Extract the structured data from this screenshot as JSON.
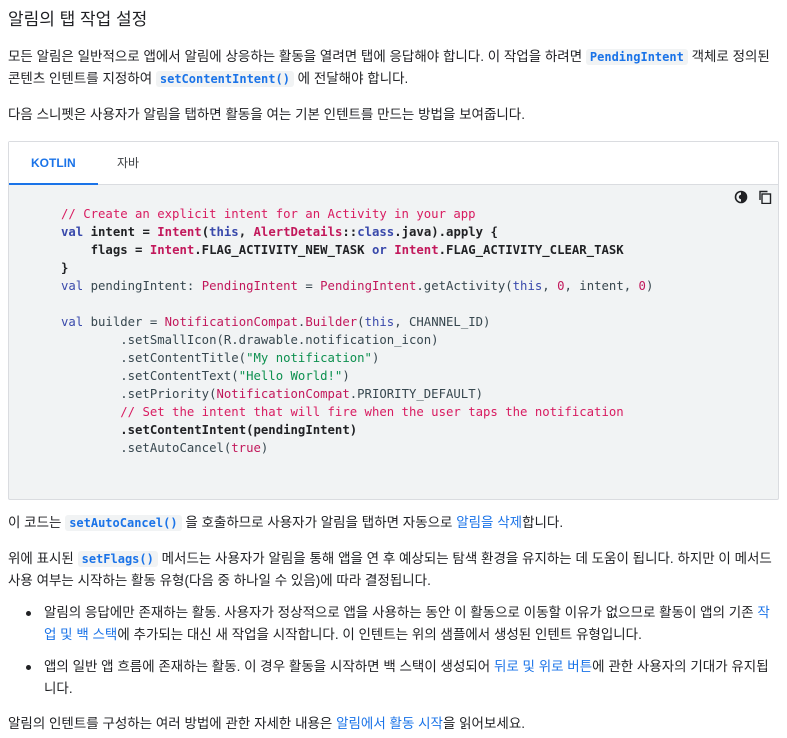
{
  "heading": "알림의 탭 작업 설정",
  "intro": {
    "text1": "모든 알림은 일반적으로 앱에서 알림에 상응하는 활동을 열려면 탭에 응답해야 합니다. 이 작업을 하려면 ",
    "code1": "PendingIntent",
    "text2": " 객체로 정의된 콘텐츠 인텐트를 지정하여 ",
    "code2": "setContentIntent()",
    "text3": " 에 전달해야 합니다."
  },
  "snippet_intro": "다음 스니펫은 사용자가 알림을 탭하면 활동을 여는 기본 인텐트를 만드는 방법을 보여줍니다.",
  "code_panel": {
    "tabs": [
      "KOTLIN",
      "자바"
    ],
    "active_tab": "KOTLIN",
    "tool_icons": [
      "dark-mode-icon",
      "copy-icon"
    ]
  },
  "code_lines": {
    "l1": "// Create an explicit intent for an Activity in your app",
    "l8": "// Set the intent that will fire when the user taps the notification"
  },
  "auto_cancel": {
    "text1": "이 코드는 ",
    "code": "setAutoCancel()",
    "text2": " 을 호출하므로 사용자가 알림을 탭하면 자동으로 ",
    "link": "알림을 삭제",
    "text3": "합니다."
  },
  "set_flags": {
    "text1": "위에 표시된 ",
    "code": "setFlags()",
    "text2": " 메서드는 사용자가 알림을 통해 앱을 연 후 예상되는 탐색 환경을 유지하는 데 도움이 됩니다. 하지만 이 메서드 사용 여부는 시작하는 활동 유형(다음 중 하나일 수 있음)에 따라 결정됩니다."
  },
  "bullets": [
    {
      "text1": "알림의 응답에만 존재하는 활동. 사용자가 정상적으로 앱을 사용하는 동안 이 활동으로 이동할 이유가 없으므로 활동이 앱의 기존 ",
      "link": "작업 및 백 스택",
      "text2": "에 추가되는 대신 새 작업을 시작합니다. 이 인텐트는 위의 샘플에서 생성된 인텐트 유형입니다."
    },
    {
      "text1": "앱의 일반 앱 흐름에 존재하는 활동. 이 경우 활동을 시작하면 백 스택이 생성되어 ",
      "link": "뒤로 및 위로 버튼",
      "text2": "에 관한 사용자의 기대가 유지됩니다."
    }
  ],
  "outro": {
    "text1": "알림의 인텐트를 구성하는 여러 방법에 관한 자세한 내용은 ",
    "link": "알림에서 활동 시작",
    "text2": "을 읽어보세요."
  }
}
